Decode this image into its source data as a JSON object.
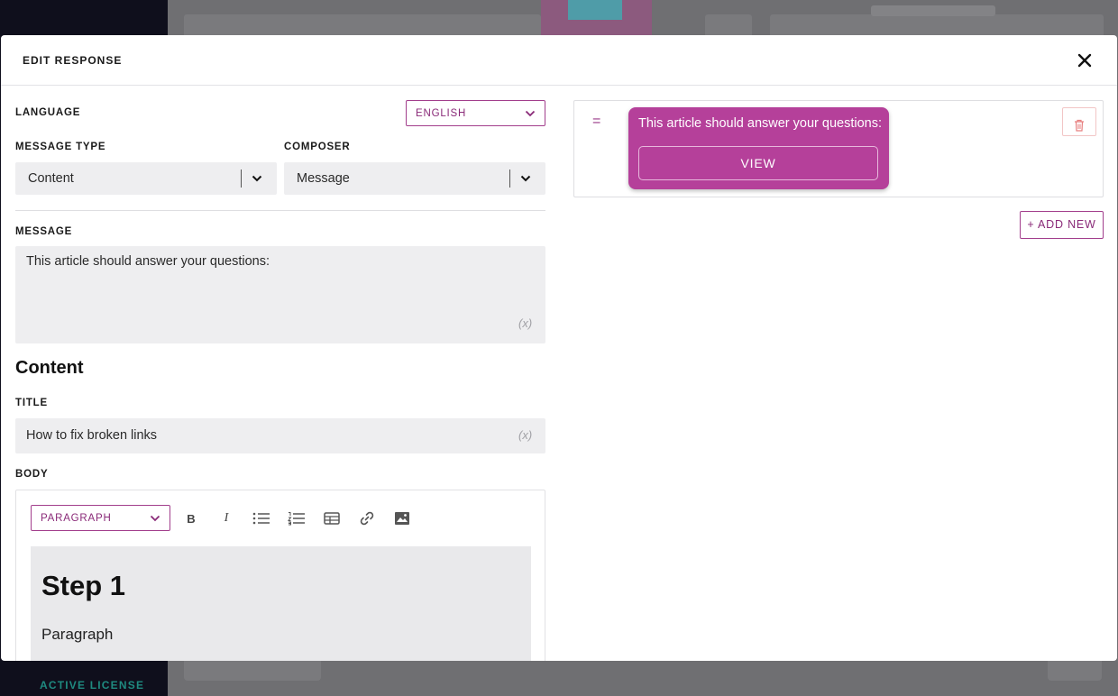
{
  "background": {
    "sidebar_footer": "ACTIVE LICENSE"
  },
  "modal": {
    "title": "EDIT RESPONSE",
    "close_icon": "close-icon"
  },
  "form": {
    "language": {
      "label": "LANGUAGE",
      "value": "ENGLISH"
    },
    "message_type": {
      "label": "MESSAGE TYPE",
      "value": "Content"
    },
    "composer": {
      "label": "COMPOSER",
      "value": "Message"
    },
    "message": {
      "label": "MESSAGE",
      "value": "This article should answer your questions:",
      "variable_hint": "(x)"
    },
    "content_section": "Content",
    "title": {
      "label": "TITLE",
      "value": "How to fix broken links",
      "variable_hint": "(x)"
    },
    "body": {
      "label": "BODY",
      "format": "PARAGRAPH",
      "toolbar": [
        "bold",
        "italic",
        "bulleted-list",
        "numbered-list",
        "table",
        "link",
        "image"
      ],
      "heading": "Step 1",
      "paragraph": "Paragraph"
    }
  },
  "preview": {
    "bubble_text": "This article should answer your questions:",
    "button_label": "VIEW",
    "add_new_label": "+ ADD NEW",
    "accent_color": "#b5409a"
  }
}
